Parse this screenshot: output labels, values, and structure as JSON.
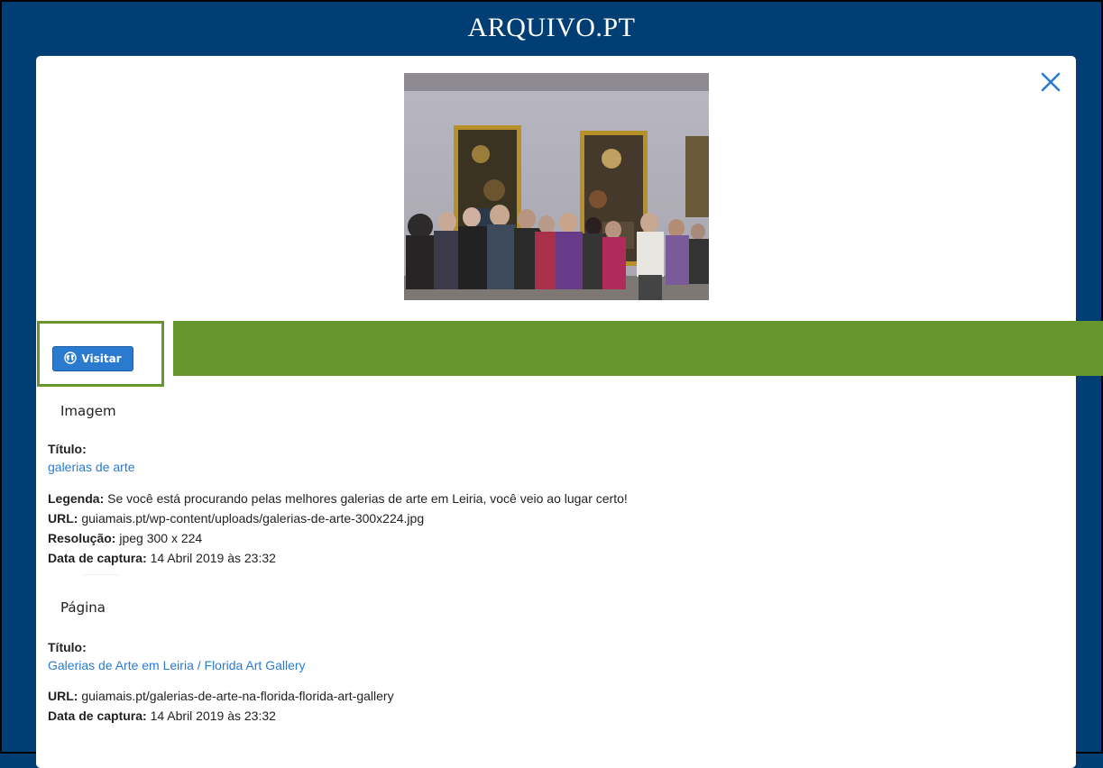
{
  "header": {
    "logo_text": "ARQUIVO.PT"
  },
  "modal": {
    "close_icon": "close-icon",
    "visit_button": {
      "label": "Visitar",
      "icon": "globe-icon"
    },
    "image_section": {
      "heading": "Imagem",
      "title_label": "Título:",
      "title_value": "galerias de arte",
      "caption_label": "Legenda:",
      "caption_value": " Se você está procurando pelas melhores galerias de arte em Leiria, você veio ao lugar certo!",
      "url_label": "URL:",
      "url_value": " guiamais.pt/wp-content/uploads/galerias-de-arte-300x224.jpg",
      "resolution_label": "Resolução:",
      "resolution_value": " jpeg 300 x 224",
      "capture_label": "Data de captura:",
      "capture_value": " 14 Abril 2019 às 23:32"
    },
    "page_section": {
      "heading": "Página",
      "title_label": "Título:",
      "title_value": "Galerias de Arte em Leiria / Florida Art Gallery",
      "url_label": "URL:",
      "url_value": " guiamais.pt/galerias-de-arte-na-florida-florida-art-gallery",
      "capture_label": "Data de captura:",
      "capture_value": " 14 Abril 2019 às 23:32"
    }
  },
  "colors": {
    "background": "#013e73",
    "accent_blue": "#2a7bd0",
    "highlight_green": "#66962d"
  }
}
